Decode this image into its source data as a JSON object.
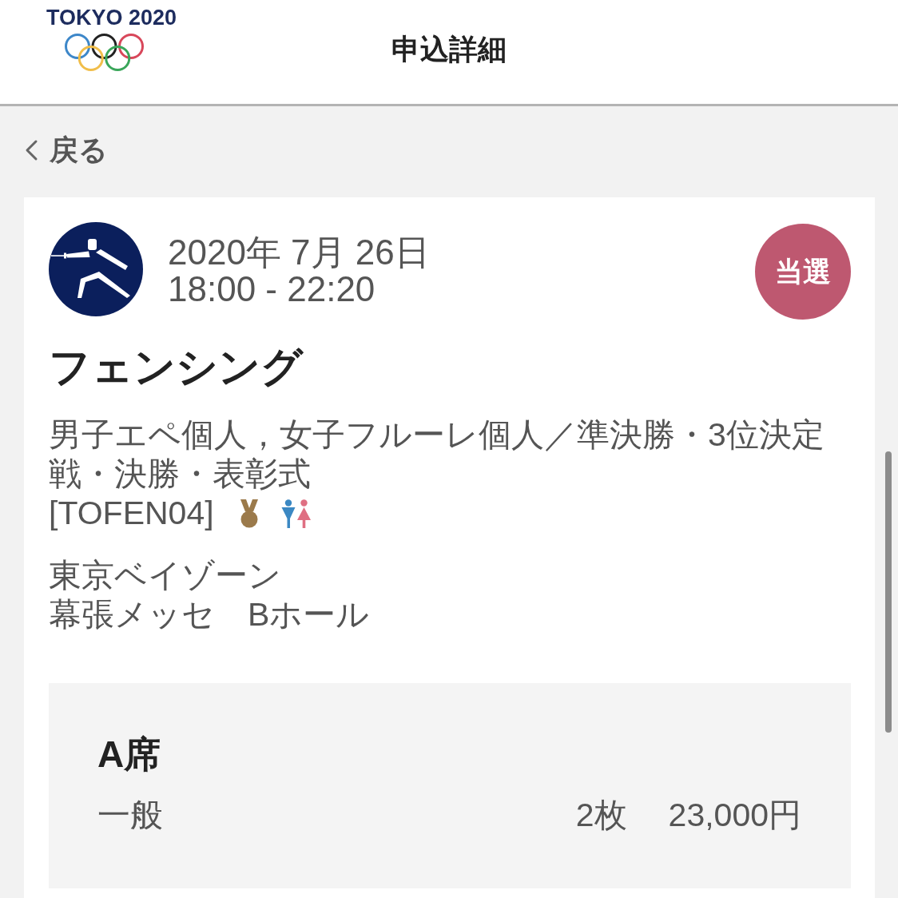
{
  "header": {
    "logo_text": "TOKYO 2020",
    "title": "申込詳細"
  },
  "back_link": {
    "label": "戻る"
  },
  "application": {
    "date": "2020年 7月 26日",
    "time": "18:00 - 22:20",
    "status": "当選",
    "sport": "フェンシング",
    "events": "男子エペ個人，女子フルーレ個人／準決勝・3位決定戦・決勝・表彰式",
    "code": "[TOFEN04]",
    "marks": [
      {
        "kind": "medal"
      },
      {
        "kind": "men_women"
      }
    ],
    "venue": [
      "東京ベイゾーン",
      "幕張メッセ　Bホール"
    ],
    "seats": [
      {
        "seat_class": "A席",
        "category": "一般",
        "quantity": "2枚",
        "price": "23,000円"
      }
    ]
  }
}
